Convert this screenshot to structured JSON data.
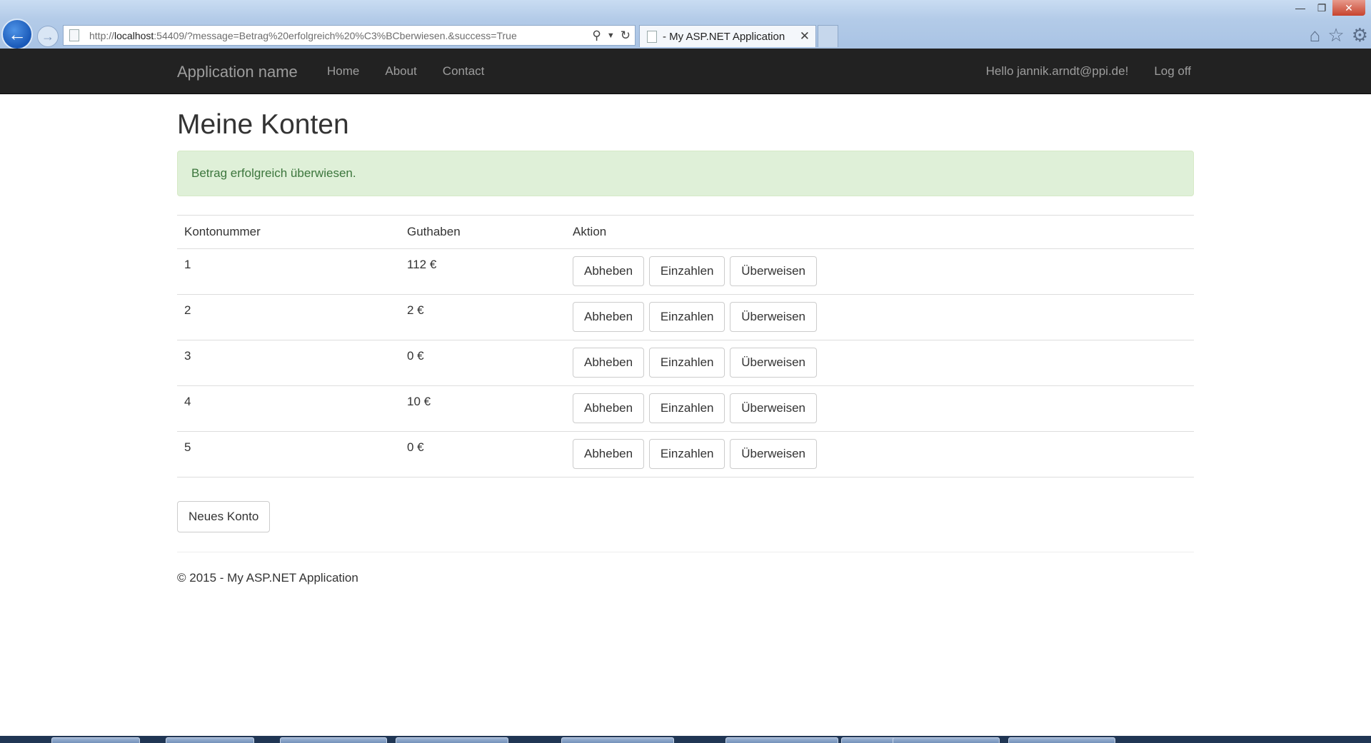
{
  "browser": {
    "url_prefix": "http://",
    "url_host": "localhost",
    "url_rest": ":54409/?message=Betrag%20erfolgreich%20%C3%BCberwiesen.&success=True",
    "tab_title": "- My ASP.NET Application",
    "tab_close": "✕",
    "window_controls": {
      "minimize": "—",
      "restore": "❐",
      "close": "✕"
    },
    "icons": [
      "home-icon",
      "star-icon",
      "gear-icon"
    ]
  },
  "navbar": {
    "brand": "Application name",
    "links": [
      "Home",
      "About",
      "Contact"
    ],
    "greeting": "Hello jannik.arndt@ppi.de!",
    "logoff": "Log off"
  },
  "main": {
    "title": "Meine Konten",
    "alert": "Betrag erfolgreich überwiesen.",
    "table": {
      "headers": [
        "Kontonummer",
        "Guthaben",
        "Aktion"
      ],
      "rows": [
        {
          "nr": "1",
          "balance": "112 €"
        },
        {
          "nr": "2",
          "balance": "2 €"
        },
        {
          "nr": "3",
          "balance": "0 €"
        },
        {
          "nr": "4",
          "balance": "10 €"
        },
        {
          "nr": "5",
          "balance": "0 €"
        }
      ],
      "actions": {
        "withdraw": "Abheben",
        "deposit": "Einzahlen",
        "transfer": "Überweisen"
      }
    },
    "new_account": "Neues Konto"
  },
  "footer": {
    "text": "© 2015 - My ASP.NET Application"
  },
  "colors": {
    "navbar_bg": "#222222",
    "navbar_text": "#9d9d9d",
    "alert_bg": "#dff0d8",
    "alert_text": "#3c763d",
    "back_button": "#1f63c4"
  }
}
